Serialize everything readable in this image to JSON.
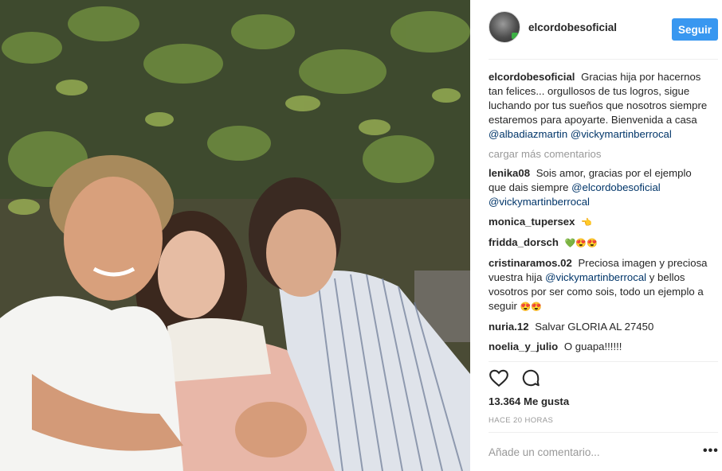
{
  "post": {
    "username": "elcordobesoficial",
    "follow_label": "Seguir",
    "caption": {
      "author": "elcordobesoficial",
      "text": "Gracias hija por hacernos tan felices... orgullosos de tus logros, sigue luchando por tus sueños que nosotros siempre estaremos para apoyarte. Bienvenida a casa",
      "mention_1": "@albadiazmartin",
      "mention_2": "@vickymartinberrocal"
    },
    "load_more": "cargar más comentarios",
    "comments": [
      {
        "author": "lenika08",
        "text": "Sois amor, gracias por el ejemplo que dais siempre",
        "mention_1": "@elcordobesoficial",
        "mention_2": "@vickymartinberrocal"
      },
      {
        "author": "monica_tupersex",
        "emoji": "👈"
      },
      {
        "author": "fridda_dorsch",
        "emoji": "💚😍😍"
      },
      {
        "author": "cristinaramos.02",
        "text_a": "Preciosa imagen y preciosa vuestra hija",
        "mention": "@vickymartinberrocal",
        "text_b": "y bellos vosotros por ser como sois, todo un ejemplo a seguir",
        "emoji": "😍😍"
      },
      {
        "author": "nuria.12",
        "text": "Salvar GLORIA AL 27450"
      },
      {
        "author": "noelia_y_julio",
        "text": "O guapa!!!!!!"
      }
    ],
    "likes": "13.364 Me gusta",
    "time": "HACE 20 HORAS",
    "add_comment_placeholder": "Añade un comentario...",
    "more_options": "•••"
  },
  "icons": {
    "like": "heart-outline-icon",
    "comment": "speech-bubble-icon",
    "options": "ellipsis-icon"
  },
  "colors": {
    "follow_button": "#3897f0",
    "mention": "#003569",
    "muted": "#999999"
  }
}
